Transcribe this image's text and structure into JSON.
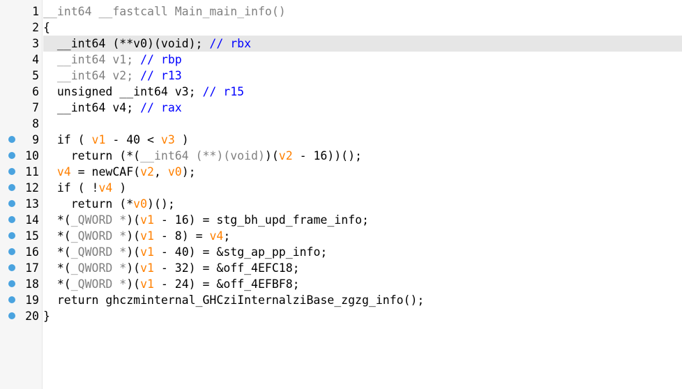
{
  "lines": [
    {
      "n": "1",
      "bp": false,
      "hl": false,
      "tokens": [
        {
          "t": "__int64 __fastcall Main_main_info()",
          "c": "typ"
        }
      ]
    },
    {
      "n": "2",
      "bp": false,
      "hl": false,
      "tokens": [
        {
          "t": "{",
          "c": "plain"
        }
      ]
    },
    {
      "n": "3",
      "bp": false,
      "hl": true,
      "tokens": [
        {
          "t": "  __int64 (**v0)(void); ",
          "c": "plain"
        },
        {
          "t": "// ",
          "c": "comment"
        },
        {
          "t": "rbx",
          "c": "regname"
        }
      ]
    },
    {
      "n": "4",
      "bp": false,
      "hl": false,
      "tokens": [
        {
          "t": "  __int64 v1; ",
          "c": "typ"
        },
        {
          "t": "// ",
          "c": "comment"
        },
        {
          "t": "rbp",
          "c": "regname"
        }
      ]
    },
    {
      "n": "5",
      "bp": false,
      "hl": false,
      "tokens": [
        {
          "t": "  __int64 v2; ",
          "c": "typ"
        },
        {
          "t": "// ",
          "c": "comment"
        },
        {
          "t": "r13",
          "c": "regname"
        }
      ]
    },
    {
      "n": "6",
      "bp": false,
      "hl": false,
      "tokens": [
        {
          "t": "  unsigned __int64 v3; ",
          "c": "plain"
        },
        {
          "t": "// ",
          "c": "comment"
        },
        {
          "t": "r15",
          "c": "regname"
        }
      ]
    },
    {
      "n": "7",
      "bp": false,
      "hl": false,
      "tokens": [
        {
          "t": "  __int64 v4; ",
          "c": "plain"
        },
        {
          "t": "// ",
          "c": "comment"
        },
        {
          "t": "rax",
          "c": "regname"
        }
      ]
    },
    {
      "n": "8",
      "bp": false,
      "hl": false,
      "tokens": []
    },
    {
      "n": "9",
      "bp": true,
      "hl": false,
      "tokens": [
        {
          "t": "  if ( ",
          "c": "plain"
        },
        {
          "t": "v1",
          "c": "var"
        },
        {
          "t": " - 40 < ",
          "c": "plain"
        },
        {
          "t": "v3",
          "c": "var"
        },
        {
          "t": " )",
          "c": "plain"
        }
      ]
    },
    {
      "n": "10",
      "bp": true,
      "hl": false,
      "tokens": [
        {
          "t": "    return (*(",
          "c": "plain"
        },
        {
          "t": "__int64 (**)(void)",
          "c": "typ"
        },
        {
          "t": ")(",
          "c": "plain"
        },
        {
          "t": "v2",
          "c": "var"
        },
        {
          "t": " - 16))();",
          "c": "plain"
        }
      ]
    },
    {
      "n": "11",
      "bp": true,
      "hl": false,
      "tokens": [
        {
          "t": "  ",
          "c": "plain"
        },
        {
          "t": "v4",
          "c": "var"
        },
        {
          "t": " = newCAF(",
          "c": "plain"
        },
        {
          "t": "v2",
          "c": "var"
        },
        {
          "t": ", ",
          "c": "plain"
        },
        {
          "t": "v0",
          "c": "var"
        },
        {
          "t": ");",
          "c": "plain"
        }
      ]
    },
    {
      "n": "12",
      "bp": true,
      "hl": false,
      "tokens": [
        {
          "t": "  if ( !",
          "c": "plain"
        },
        {
          "t": "v4",
          "c": "var"
        },
        {
          "t": " )",
          "c": "plain"
        }
      ]
    },
    {
      "n": "13",
      "bp": true,
      "hl": false,
      "tokens": [
        {
          "t": "    return (*",
          "c": "plain"
        },
        {
          "t": "v0",
          "c": "var"
        },
        {
          "t": ")();",
          "c": "plain"
        }
      ]
    },
    {
      "n": "14",
      "bp": true,
      "hl": false,
      "tokens": [
        {
          "t": "  *(",
          "c": "plain"
        },
        {
          "t": "_QWORD *",
          "c": "typ"
        },
        {
          "t": ")(",
          "c": "plain"
        },
        {
          "t": "v1",
          "c": "var"
        },
        {
          "t": " - 16) = stg_bh_upd_frame_info;",
          "c": "plain"
        }
      ]
    },
    {
      "n": "15",
      "bp": true,
      "hl": false,
      "tokens": [
        {
          "t": "  *(",
          "c": "plain"
        },
        {
          "t": "_QWORD *",
          "c": "typ"
        },
        {
          "t": ")(",
          "c": "plain"
        },
        {
          "t": "v1",
          "c": "var"
        },
        {
          "t": " - 8) = ",
          "c": "plain"
        },
        {
          "t": "v4",
          "c": "var"
        },
        {
          "t": ";",
          "c": "plain"
        }
      ]
    },
    {
      "n": "16",
      "bp": true,
      "hl": false,
      "tokens": [
        {
          "t": "  *(",
          "c": "plain"
        },
        {
          "t": "_QWORD *",
          "c": "typ"
        },
        {
          "t": ")(",
          "c": "plain"
        },
        {
          "t": "v1",
          "c": "var"
        },
        {
          "t": " - 40) = &stg_ap_pp_info;",
          "c": "plain"
        }
      ]
    },
    {
      "n": "17",
      "bp": true,
      "hl": false,
      "tokens": [
        {
          "t": "  *(",
          "c": "plain"
        },
        {
          "t": "_QWORD *",
          "c": "typ"
        },
        {
          "t": ")(",
          "c": "plain"
        },
        {
          "t": "v1",
          "c": "var"
        },
        {
          "t": " - 32) = &off_4EFC18;",
          "c": "plain"
        }
      ]
    },
    {
      "n": "18",
      "bp": true,
      "hl": false,
      "tokens": [
        {
          "t": "  *(",
          "c": "plain"
        },
        {
          "t": "_QWORD *",
          "c": "typ"
        },
        {
          "t": ")(",
          "c": "plain"
        },
        {
          "t": "v1",
          "c": "var"
        },
        {
          "t": " - 24) = &off_4EFBF8;",
          "c": "plain"
        }
      ]
    },
    {
      "n": "19",
      "bp": true,
      "hl": false,
      "tokens": [
        {
          "t": "  return ghczminternal_GHCziInternalziBase_zgzg_info();",
          "c": "plain"
        }
      ]
    },
    {
      "n": "20",
      "bp": true,
      "hl": false,
      "tokens": [
        {
          "t": "}",
          "c": "plain"
        }
      ]
    }
  ],
  "colors": {
    "breakpoint": "#4aa3df",
    "highlight_line": "#e6e6e6",
    "variable": "#ff8000",
    "comment": "#0000ff",
    "type_gray": "#808080",
    "text": "#000000"
  }
}
